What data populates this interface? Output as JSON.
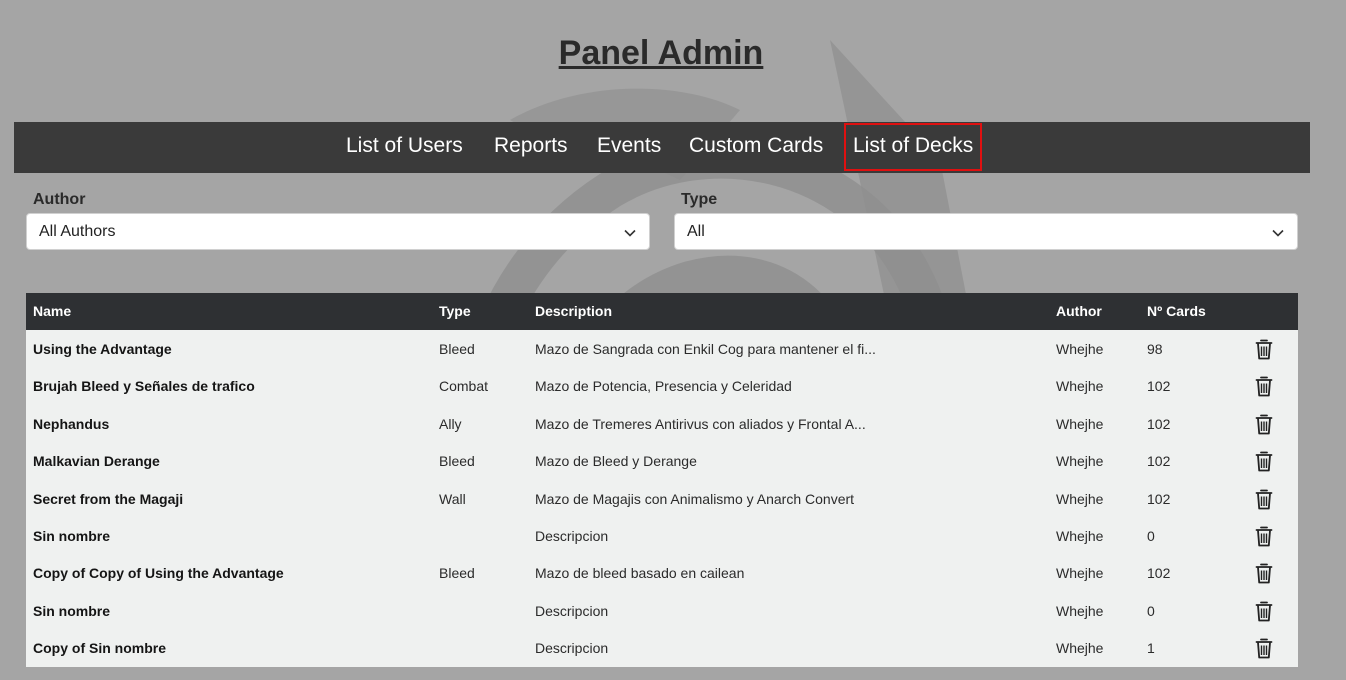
{
  "header": {
    "title": "Panel Admin"
  },
  "nav": {
    "items": [
      {
        "label": "List of Users"
      },
      {
        "label": "Reports"
      },
      {
        "label": "Events"
      },
      {
        "label": "Custom Cards"
      },
      {
        "label": "List of Decks",
        "active": true
      }
    ]
  },
  "filters": {
    "author": {
      "label": "Author",
      "value": "All Authors"
    },
    "type": {
      "label": "Type",
      "value": "All"
    }
  },
  "table": {
    "columns": [
      "Name",
      "Type",
      "Description",
      "Author",
      "Nº Cards"
    ],
    "rows": [
      {
        "name": "Using the Advantage",
        "type": "Bleed",
        "description": "Mazo de Sangrada con Enkil Cog para mantener el fi...",
        "author": "Whejhe",
        "cards": "98"
      },
      {
        "name": "Brujah Bleed y Señales de trafico",
        "type": "Combat",
        "description": "Mazo de Potencia, Presencia y Celeridad",
        "author": "Whejhe",
        "cards": "102"
      },
      {
        "name": "Nephandus",
        "type": "Ally",
        "description": "Mazo de Tremeres Antirivus con aliados y Frontal A...",
        "author": "Whejhe",
        "cards": "102"
      },
      {
        "name": "Malkavian Derange",
        "type": "Bleed",
        "description": "Mazo de Bleed y Derange",
        "author": "Whejhe",
        "cards": "102"
      },
      {
        "name": "Secret from the Magaji",
        "type": "Wall",
        "description": "Mazo de Magajis con Animalismo y Anarch Convert",
        "author": "Whejhe",
        "cards": "102"
      },
      {
        "name": "Sin nombre",
        "type": "",
        "description": "Descripcion",
        "author": "Whejhe",
        "cards": "0"
      },
      {
        "name": "Copy of Copy of Using the Advantage",
        "type": "Bleed",
        "description": "Mazo de bleed basado en cailean",
        "author": "Whejhe",
        "cards": "102"
      },
      {
        "name": "Sin nombre",
        "type": "",
        "description": "Descripcion",
        "author": "Whejhe",
        "cards": "0"
      },
      {
        "name": "Copy of Sin nombre",
        "type": "",
        "description": "Descripcion",
        "author": "Whejhe",
        "cards": "1"
      }
    ]
  },
  "icons": {
    "row_action": "trash-icon",
    "dropdown": "chevron-down-icon",
    "background": "rose-logo"
  },
  "colors": {
    "navbar": "#3a3a3a",
    "active_outline": "#e01010",
    "table_header": "#2e3033",
    "row_bg": "#eff1f0",
    "page_bg": "#a5a5a5"
  }
}
